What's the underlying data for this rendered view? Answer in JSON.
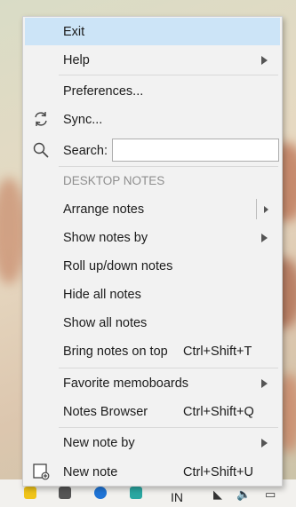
{
  "menu": {
    "exit": "Exit",
    "help": "Help",
    "preferences": "Preferences...",
    "sync": "Sync...",
    "search_label": "Search:",
    "search_value": "",
    "section_header": "DESKTOP NOTES",
    "arrange_notes": "Arrange notes",
    "show_notes_by": "Show notes by",
    "roll_up_down": "Roll up/down notes",
    "hide_all": "Hide all notes",
    "show_all": "Show all notes",
    "bring_on_top": "Bring notes on top",
    "bring_on_top_shortcut": "Ctrl+Shift+T",
    "favorite_memoboards": "Favorite memoboards",
    "notes_browser": "Notes Browser",
    "notes_browser_shortcut": "Ctrl+Shift+Q",
    "new_note_by": "New note by",
    "new_note": "New note",
    "new_note_shortcut": "Ctrl+Shift+U"
  },
  "taskbar": {
    "language": "IN"
  },
  "colors": {
    "highlight": "#cce4f7",
    "menu_bg": "#f2f2f2",
    "header_text": "#8e8e8e"
  },
  "icons": [
    "sync-icon",
    "search-icon",
    "new-note-icon",
    "submenu-arrow-icon",
    "wifi-icon",
    "volume-icon",
    "battery-icon"
  ]
}
